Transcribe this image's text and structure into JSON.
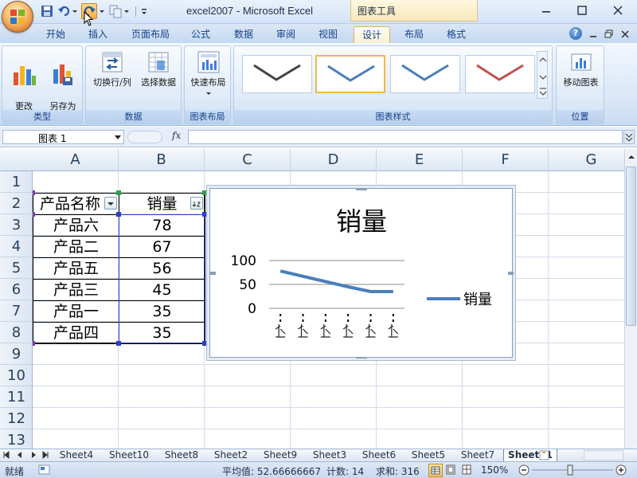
{
  "window": {
    "title": "excel2007 - Microsoft Excel",
    "tools_title": "图表工具"
  },
  "qat": {
    "icons": [
      "save-icon",
      "undo-icon",
      "redo-icon",
      "copy-icon"
    ]
  },
  "tabs": [
    {
      "label": "开始"
    },
    {
      "label": "插入"
    },
    {
      "label": "页面布局"
    },
    {
      "label": "公式"
    },
    {
      "label": "数据"
    },
    {
      "label": "审阅"
    },
    {
      "label": "视图"
    },
    {
      "label": "设计"
    },
    {
      "label": "布局"
    },
    {
      "label": "格式"
    }
  ],
  "active_tab": "设计",
  "ribbon": {
    "type_group": {
      "label": "类型",
      "change_type": "更改\n图表类型",
      "save_template": "另存为\n模板"
    },
    "data_group": {
      "label": "数据",
      "switch_row_col": "切换行/列",
      "select_data": "选择数据"
    },
    "layout_group": {
      "label": "图表布局",
      "quick_layout": "快速布局"
    },
    "styles_group": {
      "label": "图表样式"
    },
    "location_group": {
      "label": "位置",
      "move_chart": "移动图表"
    }
  },
  "style_colors": [
    "#444444",
    "#4a7ebb",
    "#4a7ebb",
    "#c0504d"
  ],
  "namebox": {
    "value": "图表 1"
  },
  "formula_bar": {
    "fx": "fx",
    "value": ""
  },
  "columns": [
    "A",
    "B",
    "C",
    "D",
    "E",
    "F",
    "G"
  ],
  "rows": [
    "1",
    "2",
    "3",
    "4",
    "5",
    "6",
    "7",
    "8",
    "9",
    "10",
    "11",
    "12",
    "13"
  ],
  "table": {
    "headers": [
      "产品名称",
      "销量"
    ],
    "rows": [
      [
        "产品六",
        "78"
      ],
      [
        "产品二",
        "67"
      ],
      [
        "产品五",
        "56"
      ],
      [
        "产品三",
        "45"
      ],
      [
        "产品一",
        "35"
      ],
      [
        "产品四",
        "35"
      ]
    ]
  },
  "chart_data": {
    "type": "line",
    "title": "销量",
    "categories": [
      "产品六",
      "产品二",
      "产品五",
      "产品三",
      "产品一",
      "产品四"
    ],
    "series": [
      {
        "name": "销量",
        "values": [
          78,
          67,
          56,
          45,
          35,
          35
        ],
        "color": "#4a7ebb"
      }
    ],
    "ylim": [
      0,
      100
    ],
    "yticks": [
      "0",
      "50",
      "100"
    ],
    "grid": true,
    "legend_position": "right"
  },
  "sheets": [
    "Sheet4",
    "Sheet10",
    "Sheet8",
    "Sheet2",
    "Sheet9",
    "Sheet3",
    "Sheet6",
    "Sheet5",
    "Sheet7",
    "Sheet11"
  ],
  "active_sheet": "Sheet11",
  "status": {
    "ready": "就绪",
    "average": "平均值: 52.66666667",
    "count": "计数: 14",
    "sum": "求和: 316",
    "zoom": "150%"
  }
}
